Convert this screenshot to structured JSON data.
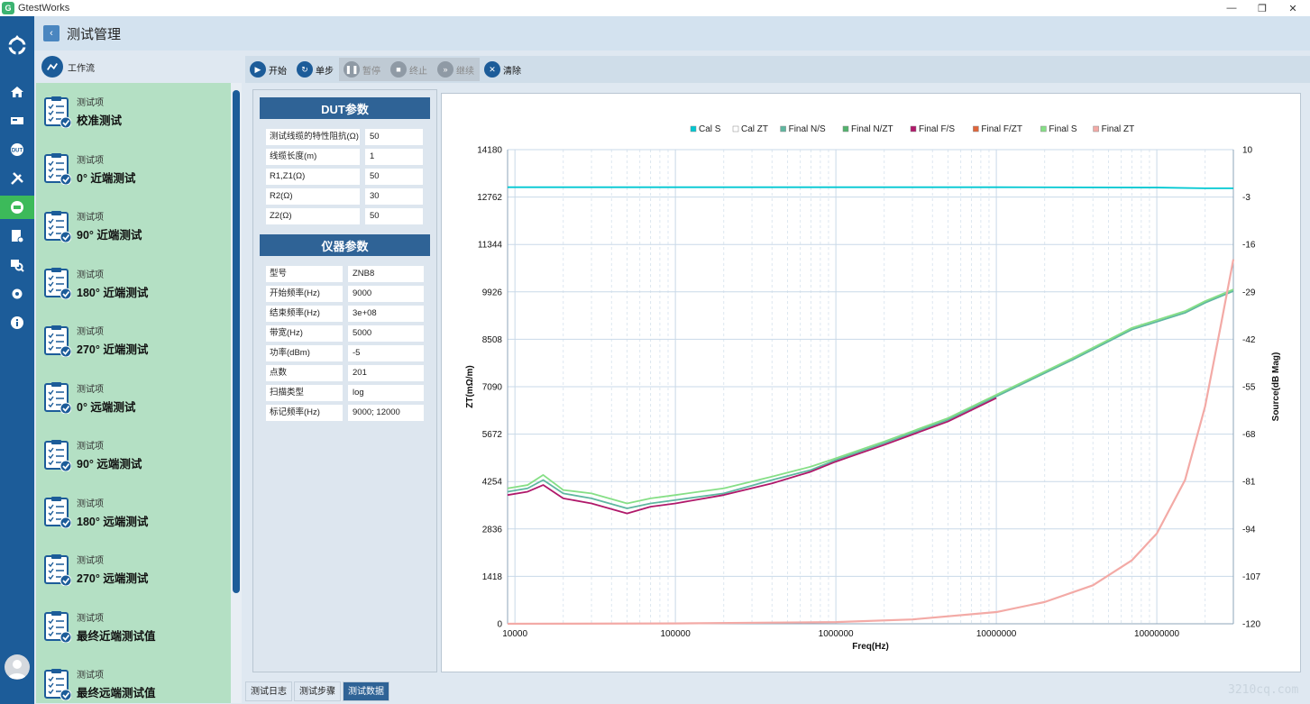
{
  "window": {
    "title": "GtestWorks",
    "minimize": "—",
    "maximize": "❐",
    "close": "✕"
  },
  "header": {
    "back": "‹",
    "title": "测试管理"
  },
  "workflow": {
    "title": "工作流",
    "items": [
      {
        "kind": "测试项",
        "name": "校准测试"
      },
      {
        "kind": "测试项",
        "name": "0° 近端测试"
      },
      {
        "kind": "测试项",
        "name": "90° 近端测试"
      },
      {
        "kind": "测试项",
        "name": "180° 近端测试"
      },
      {
        "kind": "测试项",
        "name": "270° 近端测试"
      },
      {
        "kind": "测试项",
        "name": "0° 远端测试"
      },
      {
        "kind": "测试项",
        "name": "90° 远端测试"
      },
      {
        "kind": "测试项",
        "name": "180° 远端测试"
      },
      {
        "kind": "测试项",
        "name": "270° 远端测试"
      },
      {
        "kind": "测试项",
        "name": "最终近端测试值"
      },
      {
        "kind": "测试项",
        "name": "最终远端测试值"
      }
    ]
  },
  "toolbar": {
    "start": "开始",
    "step": "单步",
    "pause": "暂停",
    "stop": "终止",
    "resume": "继续",
    "clear": "清除"
  },
  "params": {
    "dut_title": "DUT参数",
    "dut": [
      {
        "key": "测试线缆的特性阻抗(Ω)",
        "value": "50"
      },
      {
        "key": "线缆长度(m)",
        "value": "1"
      },
      {
        "key": "R1,Z1(Ω)",
        "value": "50"
      },
      {
        "key": "R2(Ω)",
        "value": "30"
      },
      {
        "key": "Z2(Ω)",
        "value": "50"
      }
    ],
    "inst_title": "仪器参数",
    "inst": [
      {
        "key": "型号",
        "value": "ZNB8"
      },
      {
        "key": "开始频率(Hz)",
        "value": "9000"
      },
      {
        "key": "结束频率(Hz)",
        "value": "3e+08"
      },
      {
        "key": "带宽(Hz)",
        "value": "5000"
      },
      {
        "key": "功率(dBm)",
        "value": "-5"
      },
      {
        "key": "点数",
        "value": "201"
      },
      {
        "key": "扫描类型",
        "value": "log"
      },
      {
        "key": "标记频率(Hz)",
        "value": "9000; 12000"
      }
    ]
  },
  "tabs": [
    "测试日志",
    "测试步骤",
    "测试数据"
  ],
  "active_tab": "测试数据",
  "watermark": "3210cq.com",
  "chart_data": {
    "type": "line",
    "xlabel": "Freq(Hz)",
    "ylabel": "ZT(mΩ/m)",
    "y2label": "Source(dB Mag)",
    "xscale": "log",
    "xlim": [
      9000,
      300000000
    ],
    "ylim": [
      0,
      14180
    ],
    "y2lim": [
      -120,
      10
    ],
    "xticks": [
      "10000",
      "100000",
      "1000000",
      "10000000",
      "100000000"
    ],
    "yticks": [
      "0",
      "1418",
      "2836",
      "4254",
      "5672",
      "7090",
      "8508",
      "9926",
      "11344",
      "12762",
      "14180"
    ],
    "y2ticks": [
      "-120",
      "-107",
      "-94",
      "-81",
      "-68",
      "-55",
      "-42",
      "-29",
      "-16",
      "-3",
      "10"
    ],
    "grid": true,
    "legend_position": "top",
    "legend": [
      "Cal S",
      "Cal ZT",
      "Final N/S",
      "Final N/ZT",
      "Final F/S",
      "Final F/ZT",
      "Final S",
      "Final ZT"
    ],
    "series": [
      {
        "name": "Cal S",
        "color": "#00c8d2",
        "axis": "y2",
        "x": [
          9000,
          100000,
          1000000,
          10000000,
          100000000,
          200000000,
          300000000
        ],
        "y": [
          -0.3,
          -0.3,
          -0.3,
          -0.3,
          -0.4,
          -0.6,
          -0.6
        ]
      },
      {
        "name": "Final N/S",
        "color": "#5fb7a0",
        "axis": "y",
        "x": [
          9000,
          12000,
          15000,
          20000,
          30000,
          50000,
          70000,
          100000,
          200000,
          400000,
          700000,
          1000000,
          2000000,
          5000000,
          10000000,
          30000000,
          70000000,
          150000000,
          200000000,
          300000000
        ],
        "y": [
          3950,
          4050,
          4300,
          3900,
          3750,
          3450,
          3600,
          3700,
          3900,
          4300,
          4600,
          4900,
          5400,
          6100,
          6800,
          7900,
          8800,
          9300,
          9600,
          9950
        ]
      },
      {
        "name": "Final F/S",
        "color": "#b0186a",
        "axis": "y",
        "x": [
          9000,
          12000,
          15000,
          20000,
          30000,
          50000,
          70000,
          100000,
          200000,
          400000,
          700000,
          1000000,
          2000000,
          5000000,
          10000000
        ],
        "y": [
          3850,
          3950,
          4150,
          3750,
          3600,
          3300,
          3500,
          3600,
          3850,
          4200,
          4550,
          4850,
          5350,
          6050,
          6750
        ]
      },
      {
        "name": "Final S",
        "color": "#86df86",
        "axis": "y",
        "x": [
          9000,
          12000,
          15000,
          20000,
          30000,
          50000,
          70000,
          100000,
          200000,
          400000,
          700000,
          1000000,
          2000000,
          5000000,
          10000000,
          30000000,
          70000000,
          150000000,
          200000000,
          300000000
        ],
        "y": [
          4050,
          4150,
          4450,
          4000,
          3900,
          3600,
          3750,
          3850,
          4050,
          4400,
          4700,
          4950,
          5450,
          6150,
          6850,
          7950,
          8850,
          9350,
          9650,
          10000
        ]
      },
      {
        "name": "Final ZT",
        "color": "#f3aaa6",
        "axis": "y",
        "x": [
          9000,
          100000,
          1000000,
          3000000,
          10000000,
          20000000,
          40000000,
          70000000,
          100000000,
          150000000,
          200000000,
          250000000,
          300000000
        ],
        "y": [
          0,
          10,
          50,
          130,
          350,
          650,
          1150,
          1900,
          2700,
          4300,
          6500,
          8900,
          10900
        ]
      }
    ]
  }
}
